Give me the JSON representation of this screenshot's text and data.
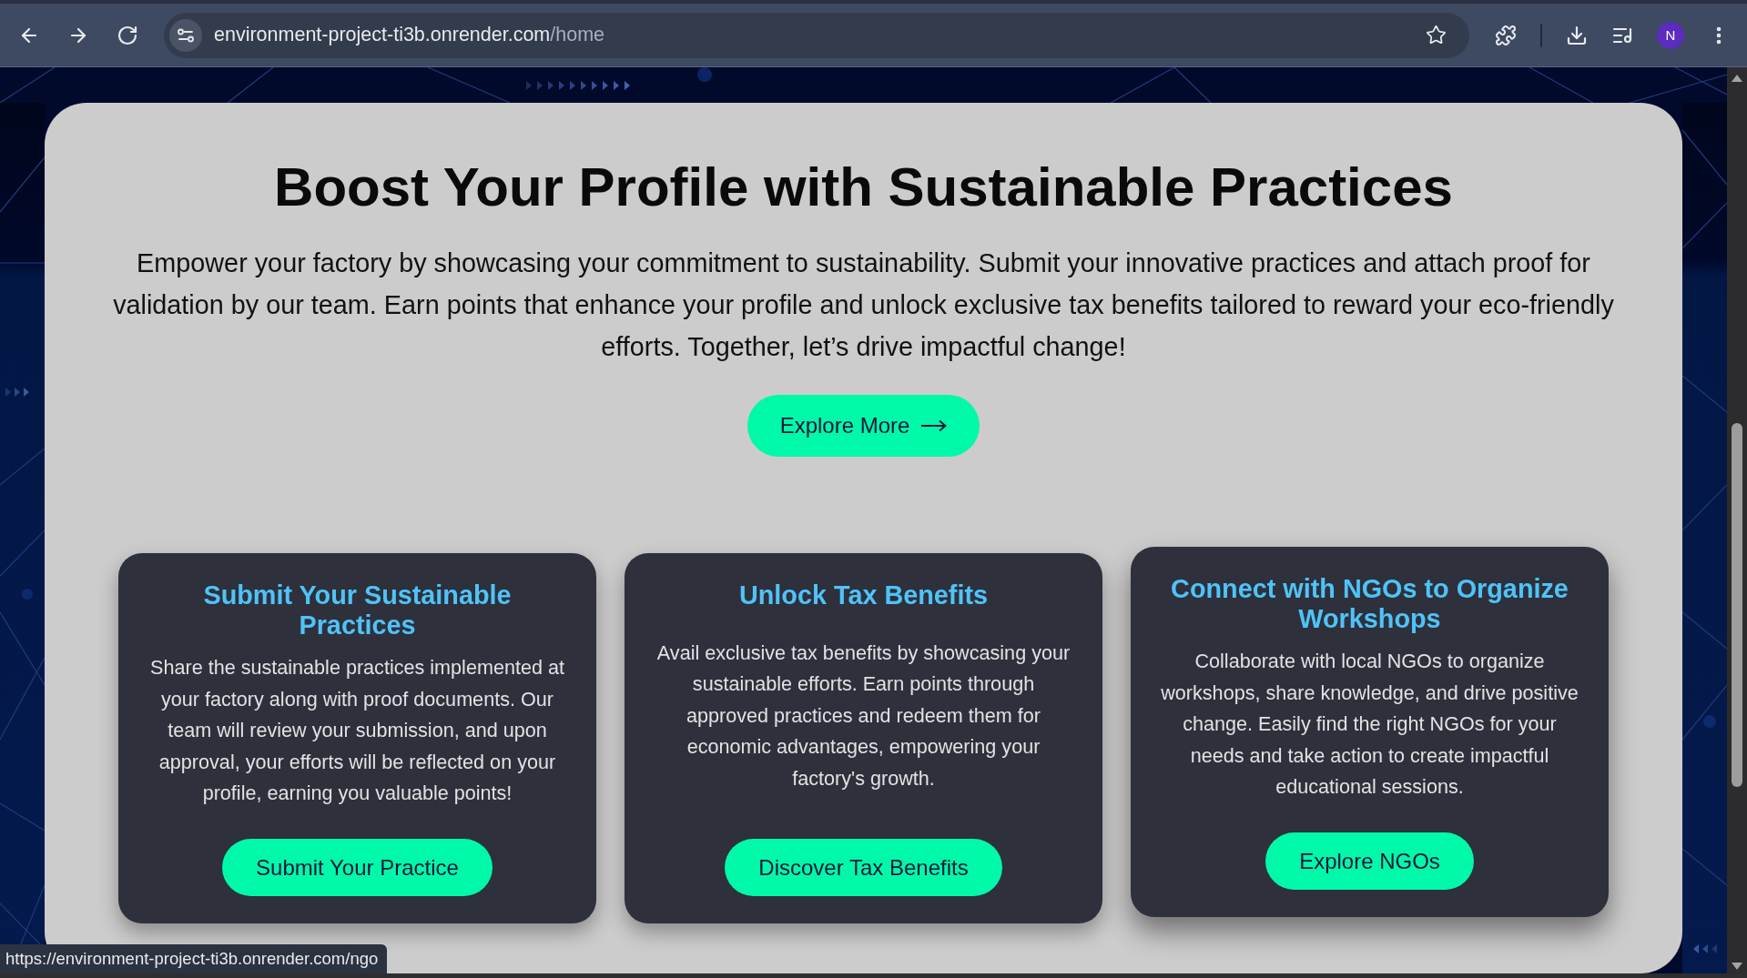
{
  "browser": {
    "url_host": "environment-project-ti3b.onrender.com",
    "url_path": "/home",
    "profile_initial": "N",
    "status_link": "https://environment-project-ti3b.onrender.com/ngo"
  },
  "hero": {
    "title": "Boost Your Profile with Sustainable Practices",
    "description": "Empower your factory by showcasing your commitment to sustainability. Submit your innovative practices and attach proof for validation by our team. Earn points that enhance your profile and unlock exclusive tax benefits tailored to reward your eco-friendly efforts. Together, let’s drive impactful change!",
    "button": "Explore More"
  },
  "cards": [
    {
      "title": "Submit Your Sustainable Practices",
      "text": "Share the sustainable practices implemented at your factory along with proof documents. Our team will review your submission, and upon approval, your efforts will be reflected on your profile, earning you valuable points!",
      "button": "Submit Your Practice",
      "hovered": false
    },
    {
      "title": "Unlock Tax Benefits",
      "text": "Avail exclusive tax benefits by showcasing your sustainable efforts. Earn points through approved practices and redeem them for economic advantages, empowering your factory's growth.",
      "button": "Discover Tax Benefits",
      "hovered": false
    },
    {
      "title": "Connect with NGOs to Organize Workshops",
      "text": "Collaborate with local NGOs to organize workshops, share knowledge, and drive positive change. Easily find the right NGOs for your needs and take action to create impactful educational sessions.",
      "button": "Explore NGOs",
      "hovered": true
    }
  ]
}
